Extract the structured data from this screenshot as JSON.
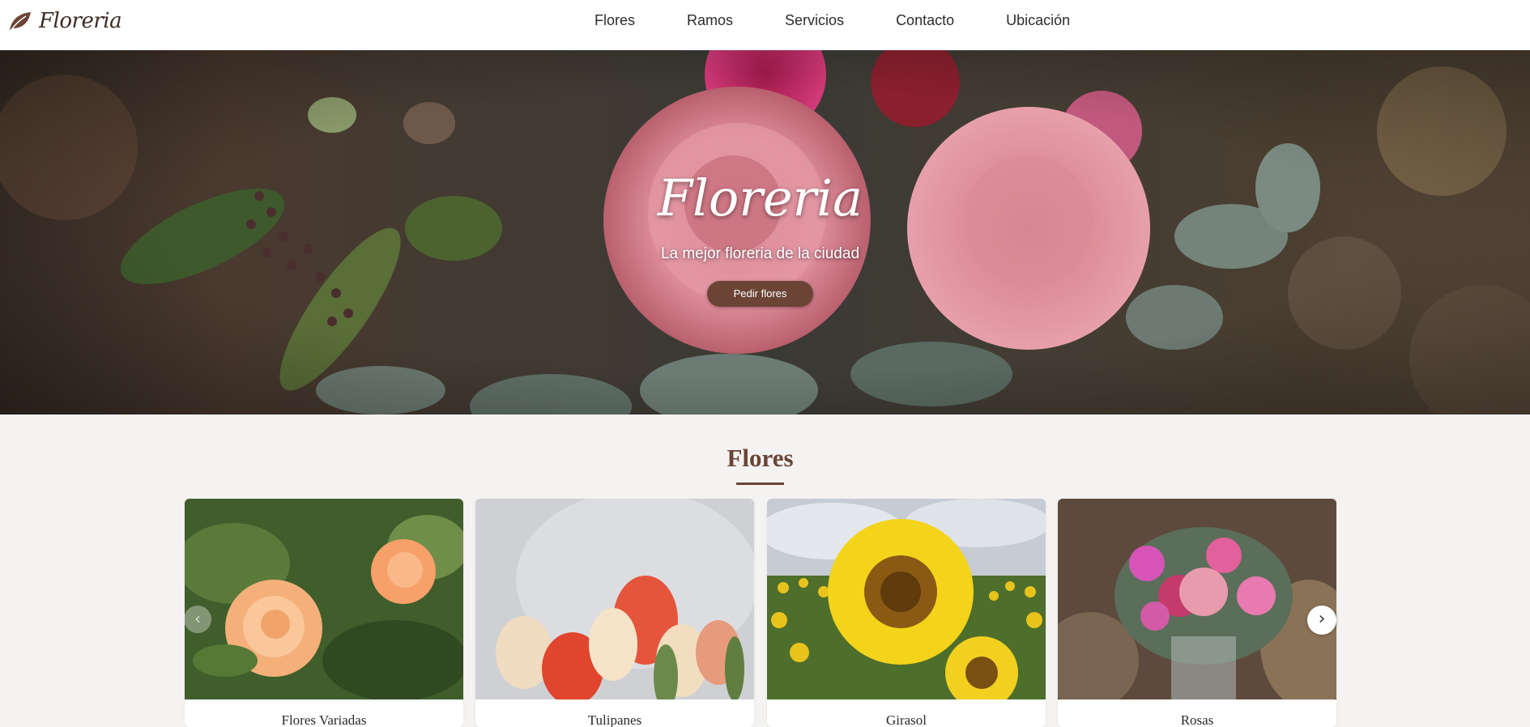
{
  "header": {
    "brand": "Floreria",
    "nav": [
      "Flores",
      "Ramos",
      "Servicios",
      "Contacto",
      "Ubicación"
    ]
  },
  "hero": {
    "title": "Floreria",
    "subtitle": "La mejor floreria de la ciudad",
    "button": "Pedir flores"
  },
  "section": {
    "title": "Flores"
  },
  "cards": [
    {
      "label": "Flores Variadas"
    },
    {
      "label": "Tulipanes"
    },
    {
      "label": "Girasol"
    },
    {
      "label": "Rosas"
    }
  ],
  "carousel": {
    "prev_icon": "‹",
    "next_icon": "›"
  },
  "colors": {
    "brand": "#6b4436",
    "background": "#f4f3f2"
  },
  "icons": {
    "brand": "leaf-icon",
    "prev": "chevron-left-icon",
    "next": "chevron-right-icon"
  }
}
